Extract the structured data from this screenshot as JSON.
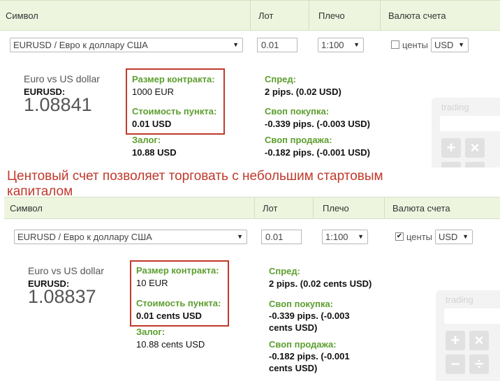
{
  "headers": {
    "symbol": "Символ",
    "lot": "Лот",
    "leverage": "Плечо",
    "account_currency": "Валюта счета"
  },
  "top": {
    "symbol_select": "EURUSD / Евро к доллару США",
    "lot_value": "0.01",
    "leverage_select": "1:100",
    "cents_checked": false,
    "cents_mark": "",
    "cents_label": "центы",
    "currency_select": "USD",
    "symbol_title": "Euro vs US dollar",
    "symbol_code": "EURUSD:",
    "price": "1.08841",
    "contract_size_label": "Размер контракта:",
    "contract_size_value": "1000 EUR",
    "pip_value_label": "Стоимость пункта:",
    "pip_value_value": "0.01 USD",
    "margin_label": "Залог:",
    "margin_value": "10.88 USD",
    "spread_label": "Спред:",
    "spread_value": "2 pips. (0.02 USD)",
    "swap_buy_label": "Своп покупка:",
    "swap_buy_value": "-0.339 pips. (-0.003 USD)",
    "swap_sell_label": "Своп продажа:",
    "swap_sell_value": "-0.182 pips. (-0.001 USD)",
    "calc_title": "trading"
  },
  "caption": "Центовый счет позволяет торговать с небольшим стартовым капиталом",
  "bottom": {
    "symbol_select": "EURUSD / Евро к доллару США",
    "lot_value": "0.01",
    "leverage_select": "1:100",
    "cents_checked": true,
    "cents_mark": "✔",
    "cents_label": "центы",
    "currency_select": "USD",
    "symbol_title": "Euro vs US dollar",
    "symbol_code": "EURUSD:",
    "price": "1.08837",
    "contract_size_label": "Размер контракта:",
    "contract_size_value": "10 EUR",
    "pip_value_label": "Стоимость пункта:",
    "pip_value_value": "0.01 cents USD",
    "margin_label": "Залог:",
    "margin_value": "10.88 cents USD",
    "spread_label": "Спред:",
    "spread_value": "2 pips. (0.02 cents USD)",
    "swap_buy_label": "Своп покупка:",
    "swap_buy_value_line1": "-0.339 pips. (-0.003",
    "swap_buy_value_line2": "cents USD)",
    "swap_sell_label": "Своп продажа:",
    "swap_sell_value_line1": "-0.182 pips. (-0.001",
    "swap_sell_value_line2": "cents USD)",
    "calc_title": "trading"
  },
  "calc_buttons": {
    "plus": "+",
    "times": "×",
    "minus": "−",
    "divide": "÷"
  },
  "colors": {
    "header_bg": "#eef5df",
    "label_green": "#5c9e2e",
    "highlight_red": "#c0392b"
  }
}
